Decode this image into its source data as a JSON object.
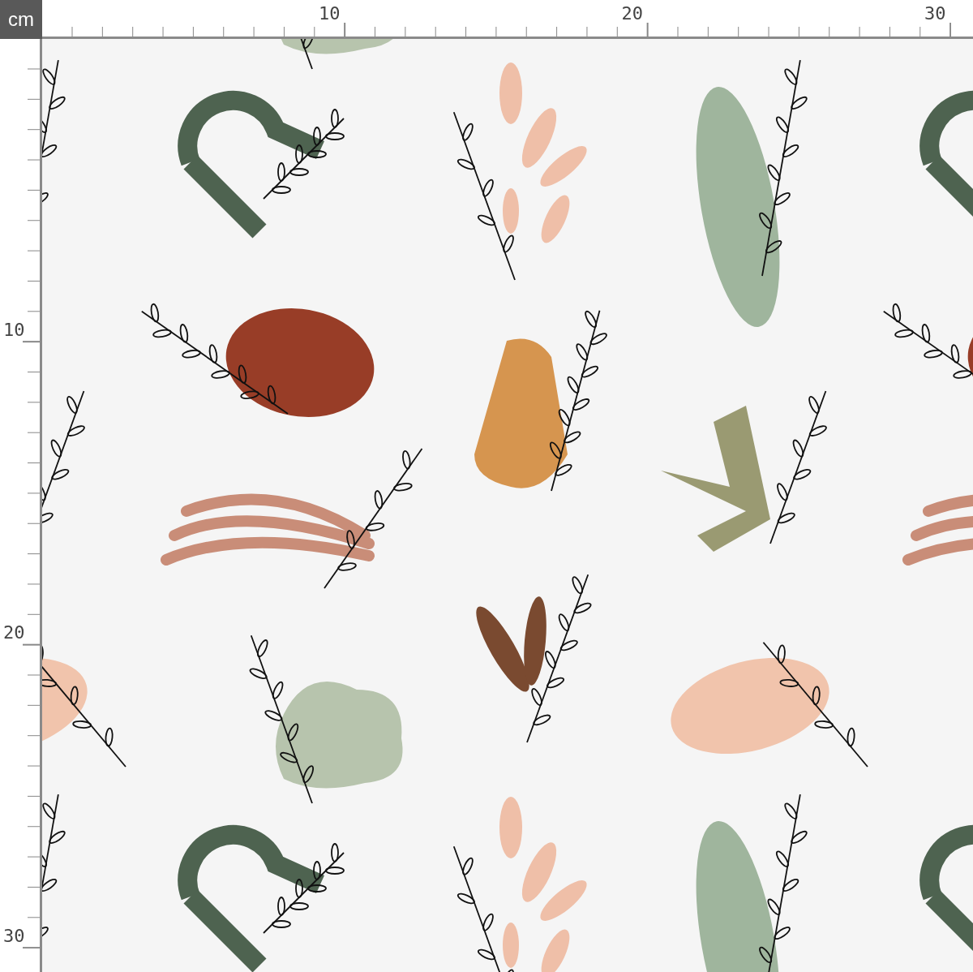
{
  "unit": "cm",
  "top_ruler": {
    "labels": [
      "10",
      "20",
      "30"
    ]
  },
  "left_ruler": {
    "labels": [
      "10",
      "20",
      "30"
    ]
  }
}
